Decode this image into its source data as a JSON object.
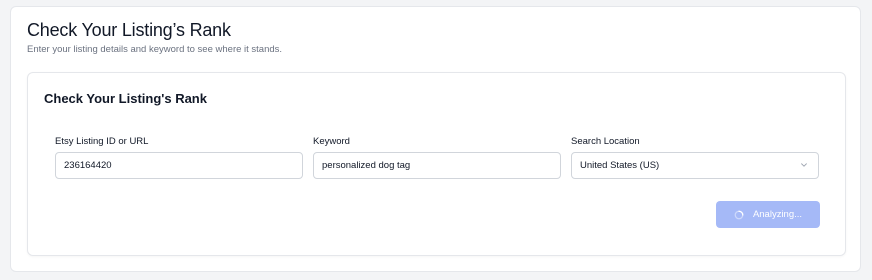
{
  "header": {
    "title": "Check Your Listing’s Rank",
    "subtitle": "Enter your listing details and keyword to see where it stands."
  },
  "form": {
    "title": "Check Your Listing's Rank",
    "listing": {
      "label": "Etsy Listing ID or URL",
      "value": "236164420"
    },
    "keyword": {
      "label": "Keyword",
      "value": "personalized dog tag"
    },
    "location": {
      "label": "Search Location",
      "selected": "United States (US)"
    },
    "submit": {
      "label": "Analyzing...",
      "icon": "spinner-icon",
      "color": "#a5b9f7"
    }
  },
  "colors": {
    "background": "#f3f4f6",
    "card": "#ffffff",
    "border": "#e5e7eb",
    "accent": "#a5b9f7"
  }
}
